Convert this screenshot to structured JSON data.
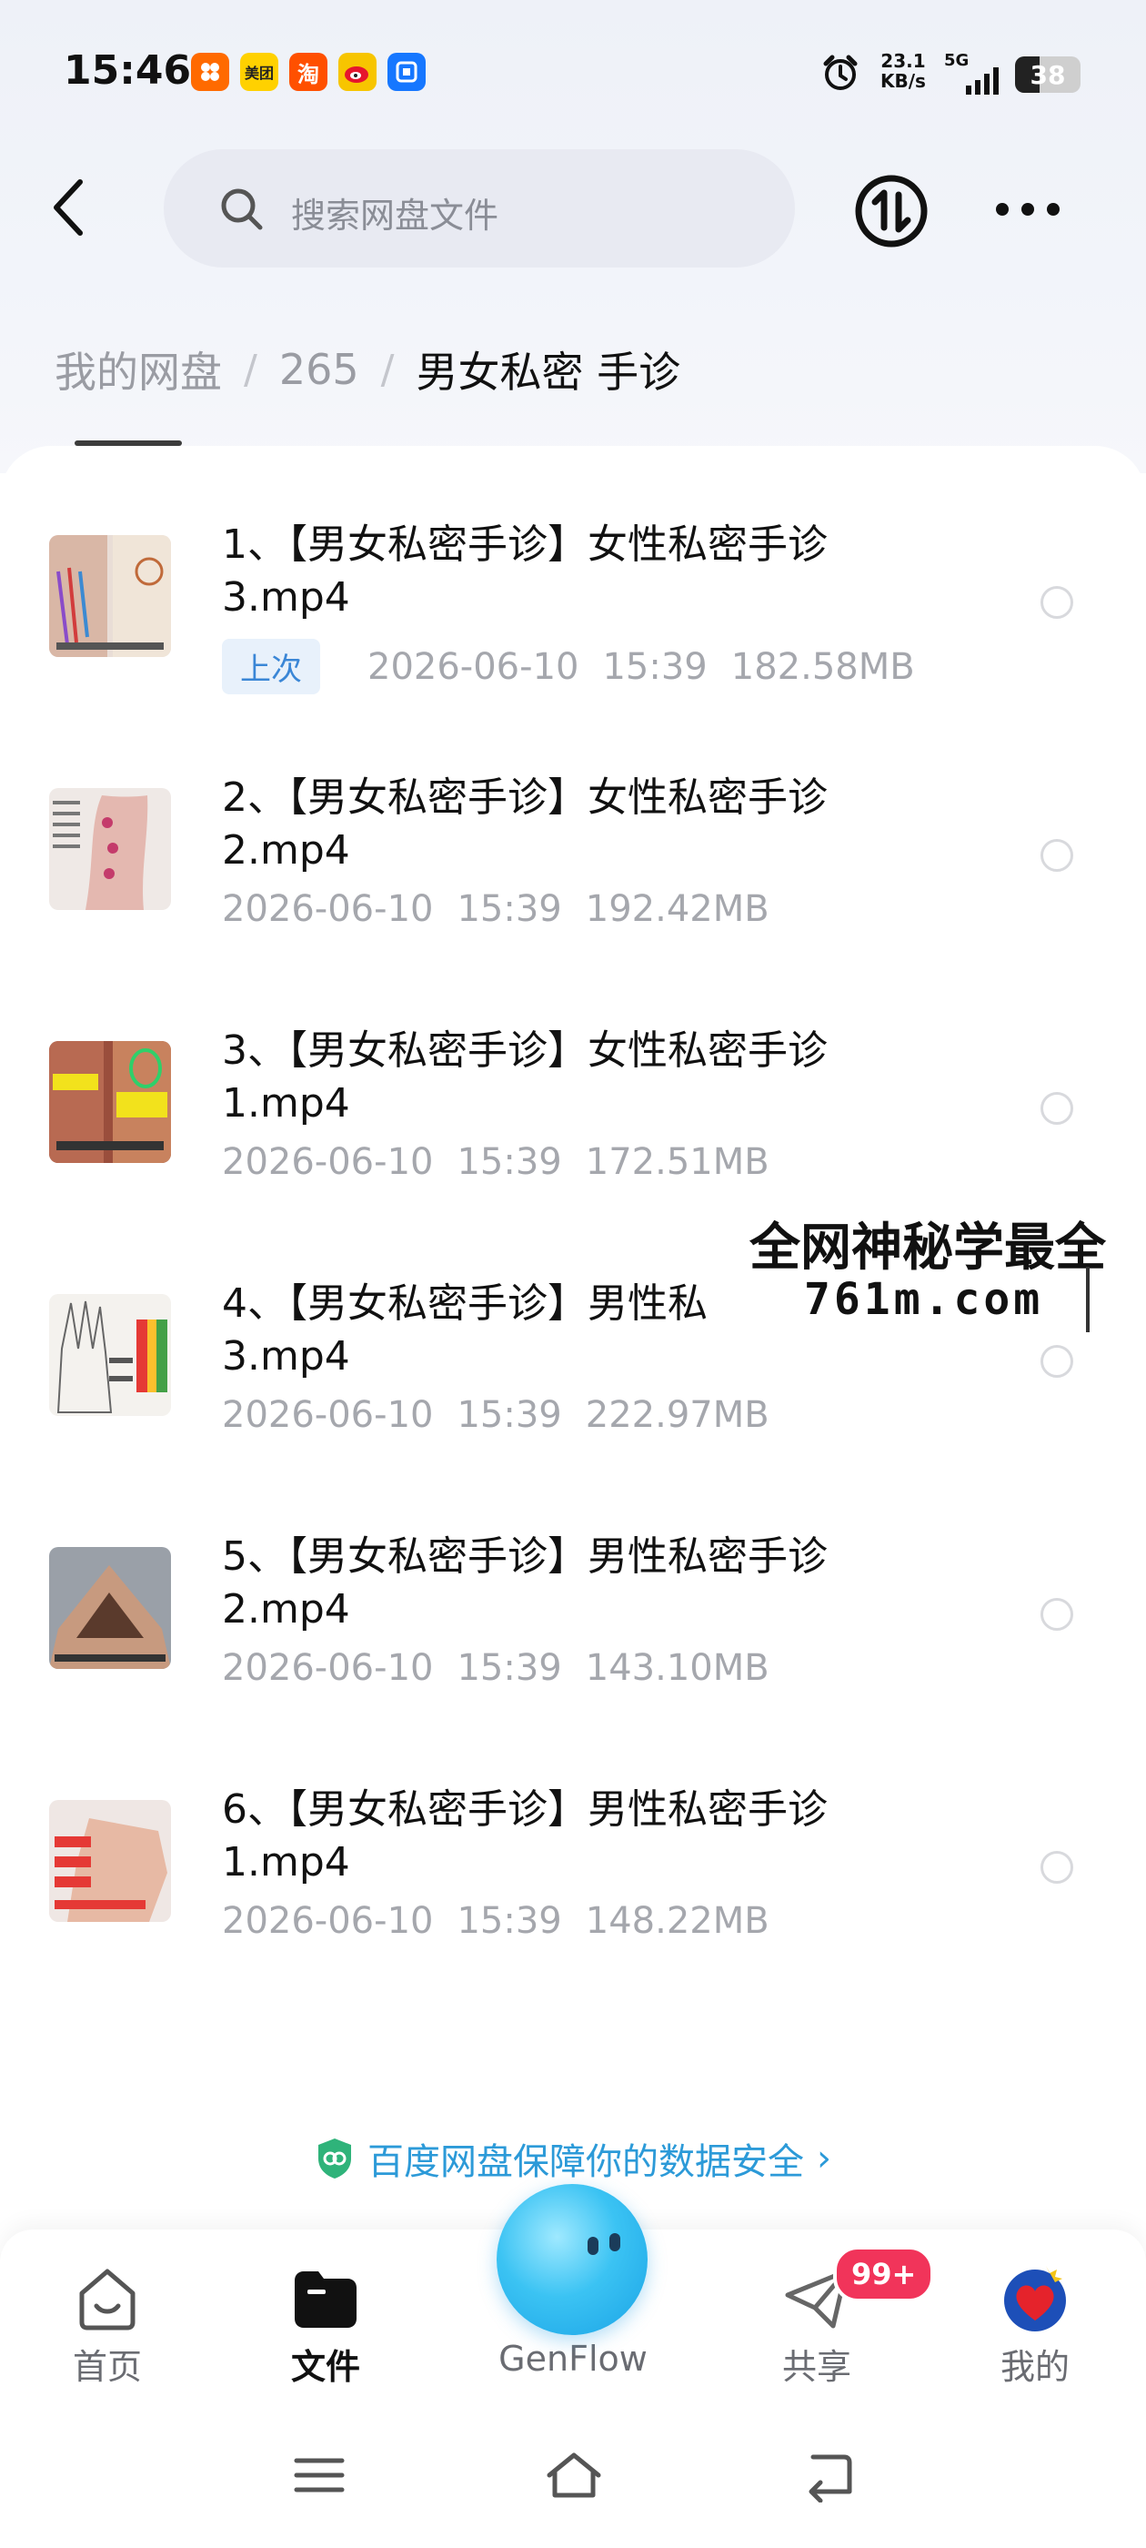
{
  "status_bar": {
    "time": "15:46",
    "apps": [
      {
        "name": "taobao-shop-icon",
        "label": "",
        "color": "#ff6a00"
      },
      {
        "name": "meituan-icon",
        "label": "美团",
        "color": "#ffd100"
      },
      {
        "name": "taobao-icon",
        "label": "淘",
        "color": "#ff5000"
      },
      {
        "name": "weibo-icon",
        "label": "",
        "color": "#e6162d"
      },
      {
        "name": "alipay-icon",
        "label": "",
        "color": "#1677ff"
      }
    ],
    "net_speed_value": "23.1",
    "net_speed_unit": "KB/s",
    "network": "5G",
    "battery": "38"
  },
  "header": {
    "search_placeholder": "搜索网盘文件"
  },
  "breadcrumb": {
    "root": "我的网盘",
    "folder": "265",
    "current": "男女私密 手诊",
    "separator": "/"
  },
  "files": [
    {
      "title": "1、【男女私密手诊】女性私密手诊3.mp4",
      "badge": "上次",
      "date": "2026-06-10",
      "time": "15:39",
      "size": "182.58MB"
    },
    {
      "title": "2、【男女私密手诊】女性私密手诊2.mp4",
      "badge": "",
      "date": "2026-06-10",
      "time": "15:39",
      "size": "192.42MB"
    },
    {
      "title": "3、【男女私密手诊】女性私密手诊1.mp4",
      "badge": "",
      "date": "2026-06-10",
      "time": "15:39",
      "size": "172.51MB"
    },
    {
      "title": "4、【男女私密手诊】男性私\n3.mp4",
      "badge": "",
      "date": "2026-06-10",
      "time": "15:39",
      "size": "222.97MB"
    },
    {
      "title": "5、【男女私密手诊】男性私密手诊2.mp4",
      "badge": "",
      "date": "2026-06-10",
      "time": "15:39",
      "size": "143.10MB"
    },
    {
      "title": "6、【男女私密手诊】男性私密手诊1.mp4",
      "badge": "",
      "date": "2026-06-10",
      "time": "15:39",
      "size": "148.22MB"
    }
  ],
  "watermark": {
    "line1": "全网神秘学最全",
    "line2": "761m.com"
  },
  "security_notice": "百度网盘保障你的数据安全",
  "bottom_nav": {
    "home": "首页",
    "files": "文件",
    "genflow": "GenFlow",
    "share": "共享",
    "share_badge": "99+",
    "mine": "我的"
  },
  "colors": {
    "accent": "#2c9ad8",
    "badge_red": "#f1345a",
    "last_badge_bg": "#e8f1fb",
    "last_badge_text": "#3a86d6"
  }
}
